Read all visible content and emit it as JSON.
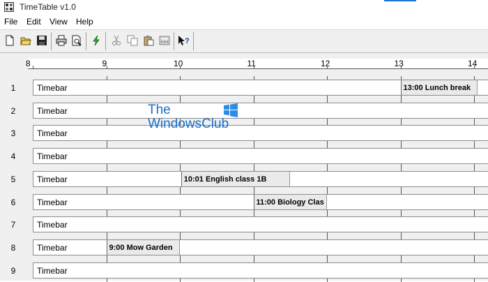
{
  "window": {
    "title": "TimeTable v1.0"
  },
  "menu": [
    "File",
    "Edit",
    "View",
    "Help"
  ],
  "toolbar": {
    "icons": [
      "new-icon",
      "open-icon",
      "save-icon",
      "print-icon",
      "print-preview-icon",
      "lightning-icon",
      "cut-icon",
      "copy-icon",
      "paste-icon",
      "calculator-icon",
      "help-pointer-icon"
    ]
  },
  "timeline": {
    "hours": [
      "8",
      "9",
      "10",
      "11",
      "12",
      "13",
      "14"
    ],
    "rows": [
      {
        "num": "1",
        "label": "Timebar",
        "events": [
          {
            "text": "13:00 Lunch break",
            "start": 13.0,
            "end": 14.05
          }
        ]
      },
      {
        "num": "2",
        "label": "Timebar",
        "events": []
      },
      {
        "num": "3",
        "label": "Timebar",
        "events": []
      },
      {
        "num": "4",
        "label": "Timebar",
        "events": []
      },
      {
        "num": "5",
        "label": "Timebar",
        "events": [
          {
            "text": "10:01 English class 1B",
            "start": 10.017,
            "end": 11.5
          }
        ]
      },
      {
        "num": "6",
        "label": "Timebar",
        "events": [
          {
            "text": "11:00 Biology Clas",
            "start": 11.0,
            "end": 12.0
          }
        ]
      },
      {
        "num": "7",
        "label": "Timebar",
        "events": []
      },
      {
        "num": "8",
        "label": "Timebar",
        "events": [
          {
            "text": "9:00 Mow Garden",
            "start": 9.0,
            "end": 10.0
          }
        ]
      },
      {
        "num": "9",
        "label": "Timebar",
        "events": []
      }
    ]
  },
  "watermark": {
    "line1": "The",
    "line2": "WindowsClub"
  }
}
